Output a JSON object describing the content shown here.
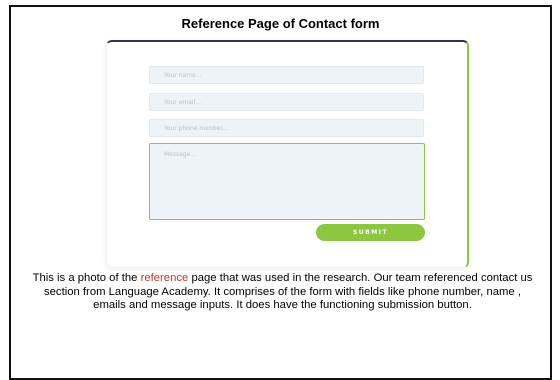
{
  "page": {
    "title": "Reference Page of Contact form"
  },
  "form": {
    "name_placeholder": "Your name...",
    "email_placeholder": "Your email...",
    "phone_placeholder": "Your phone number...",
    "message_placeholder": "Message...",
    "submit_label": "SUBMIT",
    "accent_color": "#8dc63f",
    "card_top_border_color": "#2e3640"
  },
  "caption": {
    "before": "This is a photo of the ",
    "highlight": "reference",
    "after": " page that was used in the research. Our team referenced contact us section from Language Academy. It comprises of the form with fields like phone number, name , emails and message inputs. It does have the functioning submission button.",
    "highlight_color": "#c0392b"
  }
}
